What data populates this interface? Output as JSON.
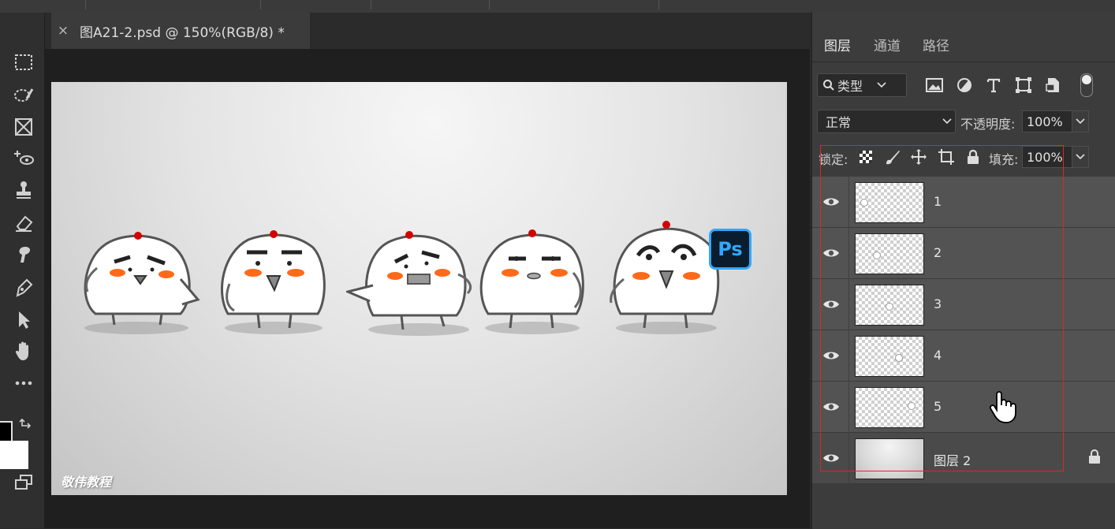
{
  "document": {
    "tab_close": "×",
    "tab_title": "图A21-2.psd @ 150%(RGB/8) *"
  },
  "canvas": {
    "watermark": "敬伟教程",
    "badge": "Ps"
  },
  "toolbar": {
    "tools": [
      "marquee-icon",
      "lasso-icon",
      "frame-icon",
      "content-aware-move-icon",
      "stamp-icon",
      "eraser-icon",
      "smudge-icon",
      "pen-icon",
      "path-select-icon",
      "hand-icon",
      "more-icon"
    ],
    "foreground_color": "#000000",
    "background_color": "#ffffff"
  },
  "panel": {
    "tabs": [
      {
        "label": "图层",
        "active": true
      },
      {
        "label": "通道",
        "active": false
      },
      {
        "label": "路径",
        "active": false
      }
    ],
    "filter": {
      "label": "类型",
      "icons": [
        "image-filter-icon",
        "adjustment-filter-icon",
        "type-filter-icon",
        "shape-filter-icon",
        "smart-object-filter-icon"
      ]
    },
    "blend_mode": "正常",
    "opacity_label": "不透明度:",
    "opacity_value": "100%",
    "lock_label": "锁定:",
    "fill_label": "填充:",
    "fill_value": "100%",
    "layers": [
      {
        "name": "1",
        "visible": true,
        "locked": false,
        "type": "transparent"
      },
      {
        "name": "2",
        "visible": true,
        "locked": false,
        "type": "transparent"
      },
      {
        "name": "3",
        "visible": true,
        "locked": false,
        "type": "transparent"
      },
      {
        "name": "4",
        "visible": true,
        "locked": false,
        "type": "transparent"
      },
      {
        "name": "5",
        "visible": true,
        "locked": false,
        "type": "transparent"
      },
      {
        "name": "图层 2",
        "visible": true,
        "locked": true,
        "type": "gradient"
      }
    ]
  },
  "colors": {
    "selection_outline": "#e0232b",
    "ps_badge": "#31a8ff"
  }
}
